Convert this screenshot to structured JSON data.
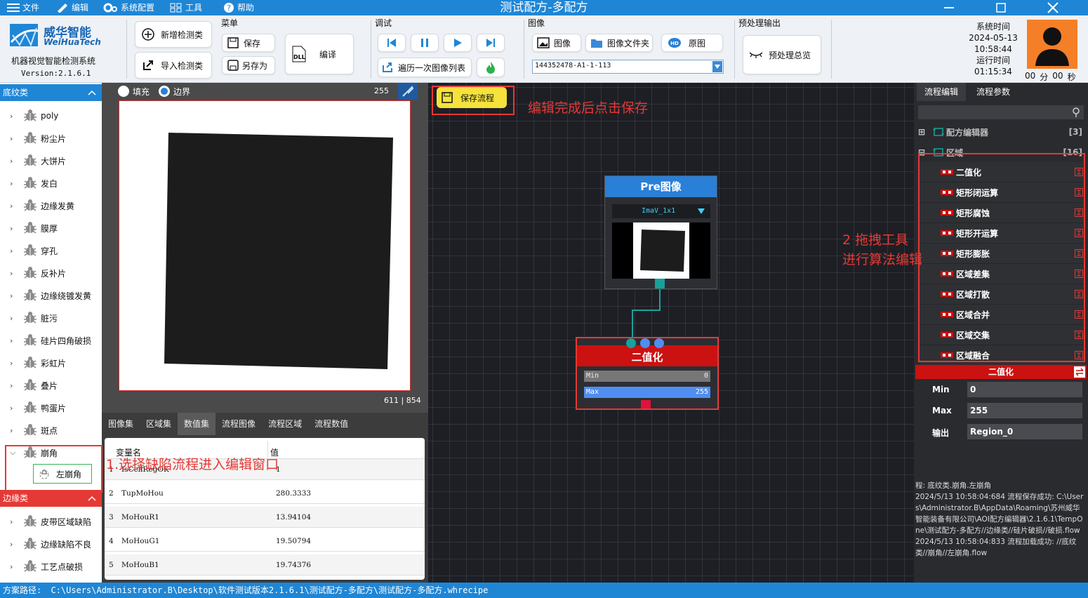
{
  "window": {
    "title": "测试配方-多配方",
    "menu": [
      "文件",
      "编辑",
      "系统配置",
      "工具",
      "帮助"
    ]
  },
  "brand": {
    "name_cn": "威华智能",
    "name_en": "WeiHuaTech",
    "system": "机器视觉智能检测系统",
    "version": "Version:2.1.6.1"
  },
  "ribbon": {
    "add_detect": "新增检测类",
    "import_detect": "导入检测类",
    "menu_group": "菜单",
    "save": "保存",
    "save_as": "另存为",
    "compile": "编译",
    "debug_group": "调试",
    "traverse": "遍历一次图像列表",
    "image_group": "图像",
    "image": "图像",
    "image_folder": "图像文件夹",
    "original": "原图",
    "image_select": "144352478-A1-1-113",
    "preprocess_group": "预处理输出",
    "preprocess_overview": "预处理总览"
  },
  "systime": {
    "label": "系统时间",
    "date": "2024-05-13",
    "time": "10:58:44",
    "run_label": "运行时间",
    "run_time": "01:15:34",
    "counter_min": "00",
    "min_unit": "分",
    "counter_sec": "00",
    "sec_unit": "秒"
  },
  "left": {
    "category1": "底纹类",
    "items": [
      "poly",
      "粉尘片",
      "大饼片",
      "发白",
      "边缘发黄",
      "膜厚",
      "穿孔",
      "反补片",
      "边缘绕镀发黄",
      "脏污",
      "硅片四角破损",
      "彩虹片",
      "叠片",
      "鸭蛋片",
      "斑点",
      "崩角"
    ],
    "child": "左崩角",
    "category2": "边缘类",
    "items2": [
      "皮带区域缺陷",
      "边缘缺陷不良",
      "工艺点破损"
    ]
  },
  "imageview": {
    "fill": "填充",
    "border": "边界",
    "gray_value": "255",
    "coords": "611 | 854"
  },
  "tabs": [
    "图像集",
    "区域集",
    "数值集",
    "流程图像",
    "流程区域",
    "流程数值"
  ],
  "active_tab": "数值集",
  "vartable": {
    "headers": [
      "变量名",
      "值"
    ],
    "rows": [
      {
        "idx": "1",
        "name": "IsCellRegOK",
        "value": "1"
      },
      {
        "idx": "2",
        "name": "TupMoHou",
        "value": "280.3333"
      },
      {
        "idx": "3",
        "name": "MoHouR1",
        "value": "13.94104"
      },
      {
        "idx": "4",
        "name": "MoHouG1",
        "value": "19.50794"
      },
      {
        "idx": "5",
        "name": "MoHouB1",
        "value": "19.74376"
      }
    ]
  },
  "canvas": {
    "save_flow": "保存流程",
    "pre_node_title": "Pre图像",
    "pre_node_select": "ImaV_1x1",
    "bin_node_title": "二值化",
    "min_label": "Min",
    "min_value": "0",
    "max_label": "Max",
    "max_value": "255",
    "max_fraction": 1.0
  },
  "annotations": {
    "save_hint": "编辑完成后点击保存",
    "drag_hint_1": "2 拖拽工具",
    "drag_hint_2": "进行算法编辑",
    "select_hint": "1.选择缺陷流程进入编辑窗口"
  },
  "right": {
    "tab_edit": "流程编辑",
    "tab_params": "流程参数",
    "tree_root": "配方编辑器",
    "tree_root_count": "[3]",
    "tree_region": "区域",
    "tree_region_count": "[16]",
    "tools": [
      "二值化",
      "矩形闭运算",
      "矩形腐蚀",
      "矩形开运算",
      "矩形膨胀",
      "区域差集",
      "区域打散",
      "区域合并",
      "区域交集",
      "区域融合"
    ],
    "param_title": "二值化",
    "params": [
      {
        "label": "Min",
        "value": "0"
      },
      {
        "label": "Max",
        "value": "255"
      },
      {
        "label": "输出",
        "value": "Region_0"
      }
    ],
    "log": "程: 底纹类.崩角.左崩角\n2024/5/13 10:58:04:684 流程保存成功: C:\\Users\\Administrator.B\\AppData\\Roaming\\苏州威华智能装备有限公司\\AOI配方编辑器\\2.1.6.1\\TempOne\\测试配方-多配方//边缘类//硅片破损//破损.flow\n2024/5/13 10:58:04:833 流程加载成功: //底纹类//崩角//左崩角.flow"
  },
  "status": {
    "label": "方案路径:",
    "path": "C:\\Users\\Administrator.B\\Desktop\\软件测试版本2.1.6.1\\测试配方-多配方\\测试配方-多配方.whrecipe"
  },
  "colors": {
    "title_blue": "#1f86d6",
    "node_red": "#cc1111",
    "node_blue": "#2a7fd6",
    "annotation_red": "#e53935"
  }
}
